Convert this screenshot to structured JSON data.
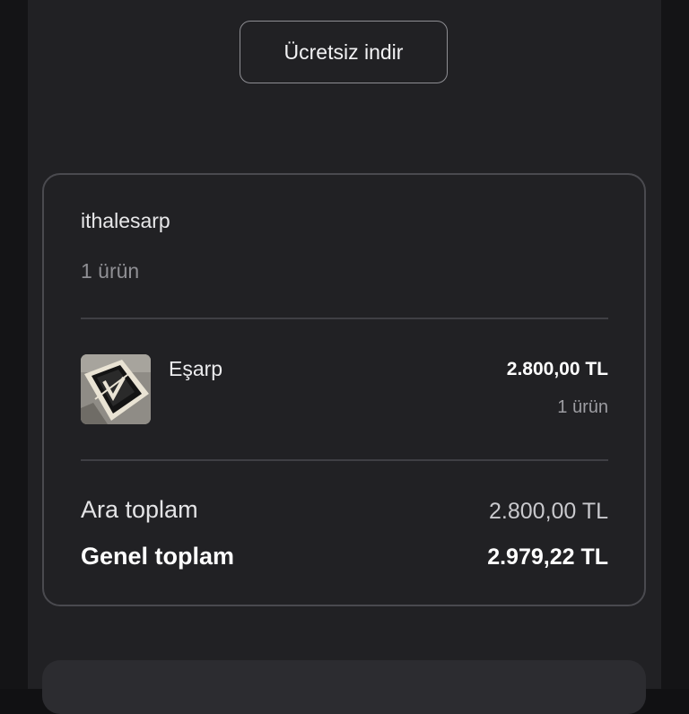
{
  "download_button": {
    "label": "Ücretsiz indir"
  },
  "order": {
    "seller": "ithalesarp",
    "seller_item_count": "1 ürün",
    "items": [
      {
        "name": "Eşarp",
        "price": "2.800,00 TL",
        "quantity": "1 ürün",
        "thumbnail_icon": "scarf-product-image"
      }
    ],
    "subtotal": {
      "label": "Ara toplam",
      "value": "2.800,00 TL"
    },
    "grand_total": {
      "label": "Genel toplam",
      "value": "2.979,22 TL"
    }
  }
}
